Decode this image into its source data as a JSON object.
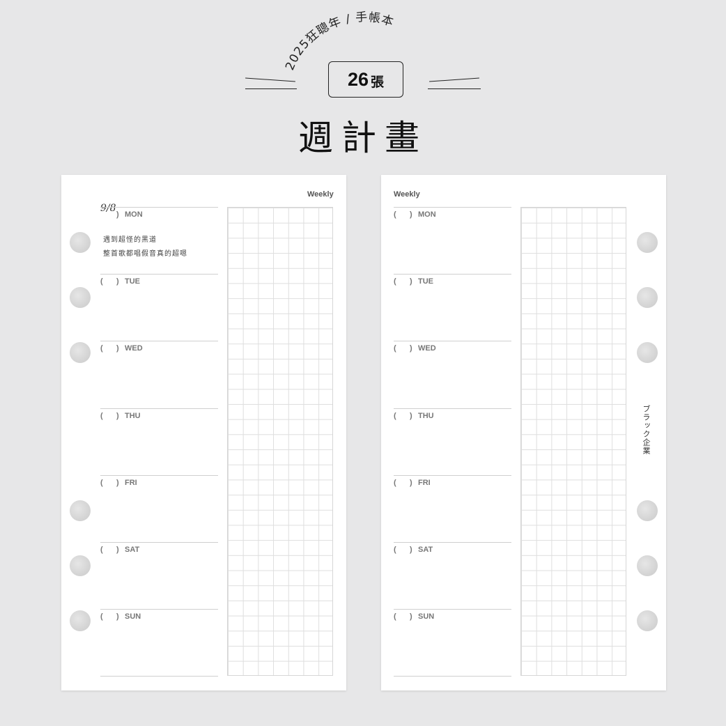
{
  "header": {
    "arc_text": "2025狂聰年 / 手帳本",
    "badge_number": "26",
    "badge_unit": "張",
    "title": "週計畫"
  },
  "left_page": {
    "weekly_label": "Weekly",
    "date_handwritten": "9/8",
    "days": [
      {
        "open": "(",
        "close": ")",
        "day": "MON"
      },
      {
        "open": "(",
        "close": ")",
        "day": "TUE"
      },
      {
        "open": "(",
        "close": ")",
        "day": "WED"
      },
      {
        "open": "(",
        "close": ")",
        "day": "THU"
      },
      {
        "open": "(",
        "close": ")",
        "day": "FRI"
      },
      {
        "open": "(",
        "close": ")",
        "day": "SAT"
      },
      {
        "open": "(",
        "close": ")",
        "day": "SUN"
      }
    ],
    "note_lines": [
      "遇到超怪的黑道",
      "整首歌都唱假音真的超嗯"
    ]
  },
  "right_page": {
    "weekly_label": "Weekly",
    "days": [
      {
        "open": "(",
        "close": ")",
        "day": "MON"
      },
      {
        "open": "(",
        "close": ")",
        "day": "TUE"
      },
      {
        "open": "(",
        "close": ")",
        "day": "WED"
      },
      {
        "open": "(",
        "close": ")",
        "day": "THU"
      },
      {
        "open": "(",
        "close": ")",
        "day": "FRI"
      },
      {
        "open": "(",
        "close": ")",
        "day": "SAT"
      },
      {
        "open": "(",
        "close": ")",
        "day": "SUN"
      }
    ],
    "side_text": "ブラック企業"
  }
}
